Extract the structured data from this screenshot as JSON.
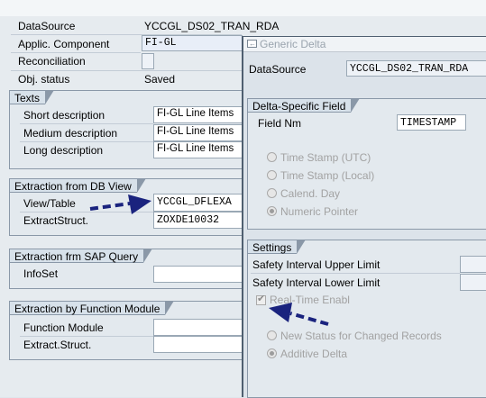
{
  "left": {
    "datasource_label": "DataSource",
    "datasource_value": "YCCGL_DS02_TRAN_RDA",
    "applic_label": "Applic. Component",
    "applic_value": "FI-GL",
    "reconciliation_label": "Reconciliation",
    "objstatus_label": "Obj. status",
    "objstatus_value": "Saved",
    "texts": {
      "title": "Texts",
      "short_label": "Short description",
      "short_value": "FI-GL Line Items",
      "medium_label": "Medium description",
      "medium_value": "FI-GL Line Items",
      "long_label": "Long description",
      "long_value": "FI-GL Line Items"
    },
    "extraction_db": {
      "title": "Extraction from DB View",
      "viewtable_label": "View/Table",
      "viewtable_value": "YCCGL_DFLEXA",
      "extractstruct_label": "ExtractStruct.",
      "extractstruct_value": "ZOXDE10032"
    },
    "extraction_query": {
      "title": "Extraction frm SAP Query",
      "infoset_label": "InfoSet"
    },
    "extraction_fm": {
      "title": "Extraction by Function Module",
      "fm_label": "Function Module",
      "struct_label": "Extract.Struct."
    }
  },
  "dialog": {
    "title": "Generic Delta",
    "datasource_label": "DataSource",
    "datasource_value": "YCCGL_DS02_TRAN_RDA",
    "delta_field": {
      "title": "Delta-Specific Field",
      "field_label": "Field Nm",
      "field_value": "TIMESTAMP",
      "options": [
        "Time Stamp (UTC)",
        "Time Stamp (Local)",
        "Calend. Day",
        "Numeric Pointer"
      ],
      "selected": "Numeric Pointer"
    },
    "settings": {
      "title": "Settings",
      "upper_label": "Safety Interval Upper Limit",
      "lower_label": "Safety Interval Lower Limit",
      "realtime_label": "Real-Time Enabl",
      "realtime_checked": true,
      "options": [
        "New Status for Changed Records",
        "Additive Delta"
      ],
      "selected": "Additive Delta"
    }
  },
  "colors": {
    "arrow": "#1a237e"
  }
}
